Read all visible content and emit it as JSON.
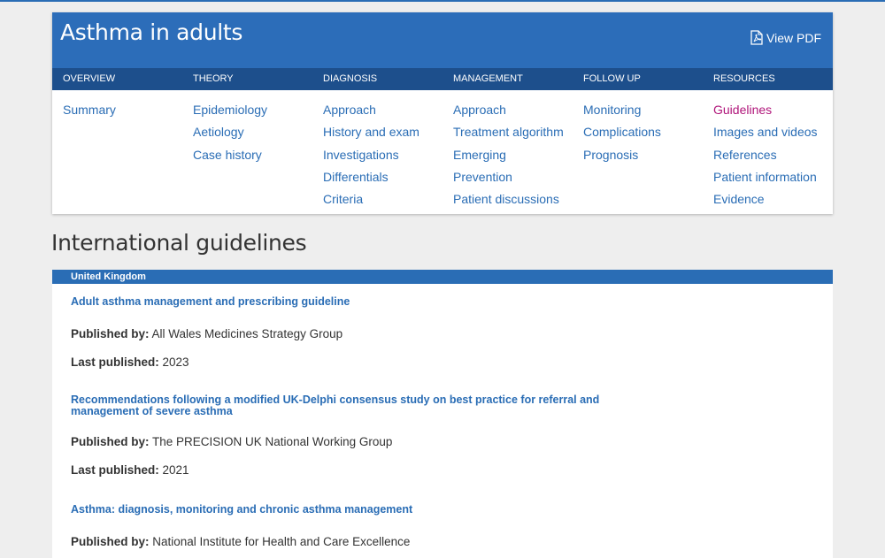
{
  "topic": {
    "title": "Asthma in adults",
    "view_pdf_label": "View PDF"
  },
  "nav": {
    "columns": [
      {
        "heading": "OVERVIEW",
        "links": [
          "Summary"
        ]
      },
      {
        "heading": "THEORY",
        "links": [
          "Epidemiology",
          "Aetiology",
          "Case history"
        ]
      },
      {
        "heading": "DIAGNOSIS",
        "links": [
          "Approach",
          "History and exam",
          "Investigations",
          "Differentials",
          "Criteria"
        ]
      },
      {
        "heading": "MANAGEMENT",
        "links": [
          "Approach",
          "Treatment algorithm",
          "Emerging",
          "Prevention",
          "Patient discussions"
        ]
      },
      {
        "heading": "FOLLOW UP",
        "links": [
          "Monitoring",
          "Complications",
          "Prognosis"
        ]
      },
      {
        "heading": "RESOURCES",
        "links": [
          "Guidelines",
          "Images and videos",
          "References",
          "Patient information",
          "Evidence"
        ]
      }
    ],
    "active_link": "Guidelines"
  },
  "section_title": "International guidelines",
  "region": "United Kingdom",
  "published_by_label": "Published by:",
  "last_published_label": "Last published:",
  "guidelines": [
    {
      "title": "Adult asthma management and prescribing guideline",
      "publisher": "All Wales Medicines Strategy Group",
      "year": "2023"
    },
    {
      "title": "Recommendations following a modified UK-Delphi consensus study on best practice for referral and management of severe asthma",
      "publisher": "The PRECISION UK National Working Group",
      "year": "2021"
    },
    {
      "title": "Asthma: diagnosis, monitoring and chronic asthma management",
      "publisher": "National Institute for Health and Care Excellence",
      "year": ""
    }
  ],
  "colors": {
    "header_blue": "#2c6db9",
    "nav_dark_blue": "#1d4f8c",
    "link_blue": "#2a6db5",
    "active_magenta": "#b0157a"
  },
  "icons": {
    "pdf": "pdf-file-icon"
  }
}
